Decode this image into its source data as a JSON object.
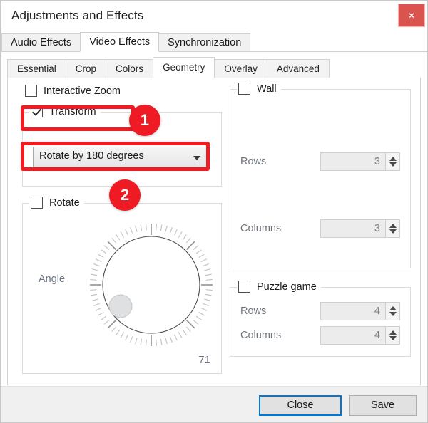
{
  "window": {
    "title": "Adjustments and Effects",
    "close_icon": "close-icon",
    "close_glyph": "×"
  },
  "main_tabs": [
    {
      "label": "Audio Effects",
      "active": false
    },
    {
      "label": "Video Effects",
      "active": true
    },
    {
      "label": "Synchronization",
      "active": false
    }
  ],
  "sub_tabs": [
    {
      "label": "Essential",
      "active": false
    },
    {
      "label": "Crop",
      "active": false
    },
    {
      "label": "Colors",
      "active": false
    },
    {
      "label": "Geometry",
      "active": true
    },
    {
      "label": "Overlay",
      "active": false
    },
    {
      "label": "Advanced",
      "active": false
    }
  ],
  "left": {
    "interactive_zoom": {
      "label": "Interactive Zoom",
      "checked": false
    },
    "transform": {
      "label": "Transform",
      "checked": true,
      "mode_value": "Rotate by 180 degrees"
    },
    "rotate": {
      "label": "Rotate",
      "checked": false,
      "angle_label": "Angle",
      "angle_value": "71"
    }
  },
  "right": {
    "wall": {
      "label": "Wall",
      "checked": false,
      "rows_label": "Rows",
      "rows_value": "3",
      "columns_label": "Columns",
      "columns_value": "3"
    },
    "puzzle": {
      "label": "Puzzle game",
      "checked": false,
      "rows_label": "Rows",
      "rows_value": "4",
      "columns_label": "Columns",
      "columns_value": "4"
    }
  },
  "annotations": {
    "badge_one": "1",
    "badge_two": "2",
    "highlight_color": "#ef1c24"
  },
  "footer": {
    "close_label": "Close",
    "close_accel": "C",
    "close_rest": "lose",
    "save_label": "Save",
    "save_accel": "S",
    "save_rest": "ave"
  }
}
